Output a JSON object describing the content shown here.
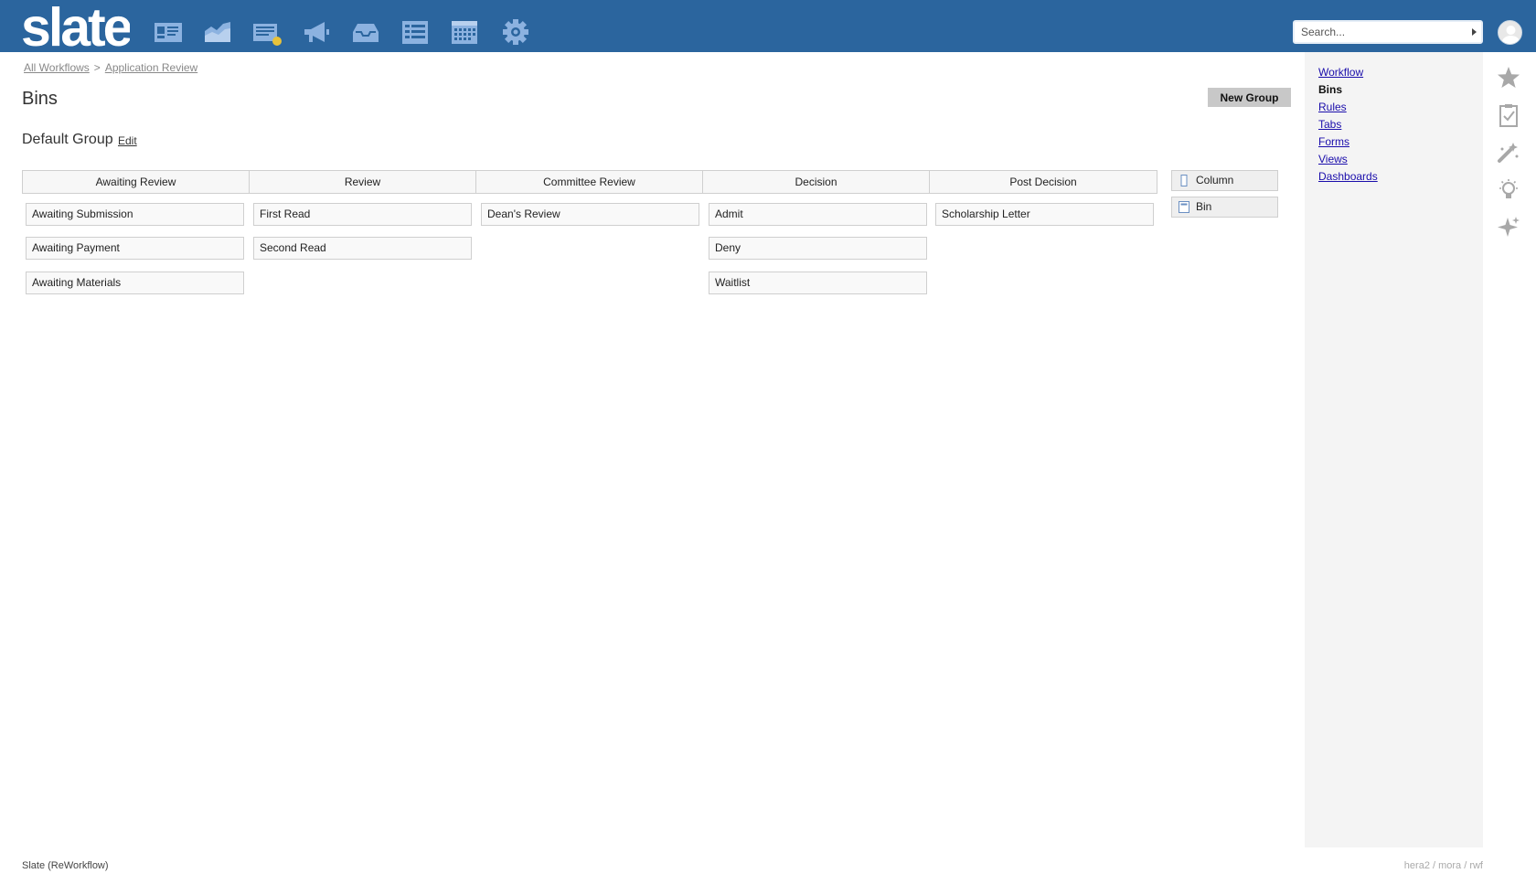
{
  "app": {
    "logo_text": "slate",
    "brand_color": "#2b659e",
    "nav_icons": [
      "contact-card-icon",
      "chart-area-icon",
      "news-list-icon",
      "megaphone-icon",
      "inbox-tray-icon",
      "forms-list-icon",
      "calendar-icon",
      "gear-icon"
    ]
  },
  "search": {
    "placeholder": "Search..."
  },
  "breadcrumb": {
    "items": [
      "All Workflows",
      "Application Review"
    ],
    "separator": ">"
  },
  "page": {
    "title": "Bins",
    "new_group_label": "New Group"
  },
  "group": {
    "title": "Default Group",
    "edit_label": "Edit"
  },
  "board": {
    "columns": [
      {
        "title": "Awaiting Review",
        "bins": [
          "Awaiting Submission",
          "Awaiting Payment",
          "Awaiting Materials"
        ]
      },
      {
        "title": "Review",
        "bins": [
          "First Read",
          "Second Read"
        ]
      },
      {
        "title": "Committee Review",
        "bins": [
          "Dean's Review"
        ]
      },
      {
        "title": "Decision",
        "bins": [
          "Admit",
          "Deny",
          "Waitlist"
        ]
      },
      {
        "title": "Post Decision",
        "bins": [
          "Scholarship Letter"
        ]
      }
    ]
  },
  "palette": {
    "column_label": "Column",
    "bin_label": "Bin"
  },
  "sidebar": {
    "links": [
      "Workflow",
      "Bins",
      "Rules",
      "Tabs",
      "Forms",
      "Views",
      "Dashboards"
    ],
    "active": "Bins"
  },
  "rail_icons": [
    "star-icon",
    "clipboard-check-icon",
    "magic-wand-icon",
    "lightbulb-icon",
    "sparkle-icon"
  ],
  "footer": {
    "left": "Slate (ReWorkflow)",
    "right": "hera2 / mora / rwf"
  }
}
